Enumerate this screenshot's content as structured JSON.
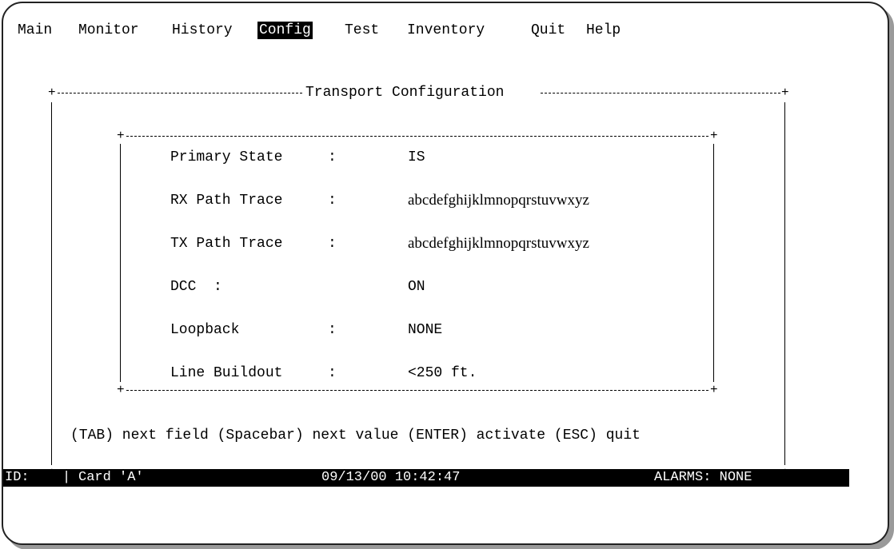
{
  "menu": {
    "items": [
      "Main",
      "Monitor",
      "History",
      "Config",
      "Test",
      "Inventory",
      "Quit",
      "Help"
    ],
    "active": "Config"
  },
  "dialog": {
    "title": "Transport Configuration",
    "fields": [
      {
        "label": "Primary State",
        "sep": ":",
        "value": "IS"
      },
      {
        "label": "RX Path Trace",
        "sep": ":",
        "value": "abcdefghijklmnopqrstuvwxyz"
      },
      {
        "label": "TX Path Trace",
        "sep": ":",
        "value": "abcdefghijklmnopqrstuvwxyz"
      },
      {
        "label": "DCC  :",
        "sep": "",
        "value": "ON"
      },
      {
        "label": "Loopback",
        "sep": ":",
        "value": "NONE"
      },
      {
        "label": "Line Buildout",
        "sep": ":",
        "value": "<250 ft."
      }
    ],
    "help_text": "(TAB) next field (Spacebar) next value (ENTER) activate (ESC) quit"
  },
  "status": {
    "id_label": "ID:",
    "card": "Card 'A'",
    "datetime": "09/13/00 10:42:47",
    "alarms": "ALARMS: NONE"
  }
}
